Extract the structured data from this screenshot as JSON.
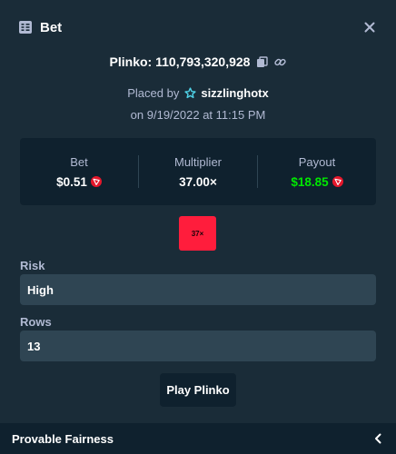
{
  "header": {
    "title": "Bet",
    "icon": "bet-slip-icon",
    "close_icon": "close-icon"
  },
  "bet": {
    "game_title": "Plinko: 110,793,320,928",
    "copy_icon": "copy-icon",
    "link_icon": "link-icon",
    "placed_by_prefix": "Placed by",
    "user_icon": "vip-star-icon",
    "username": "sizzlinghotx",
    "date": "on 9/19/2022 at 11:15 PM"
  },
  "stats": {
    "bet_label": "Bet",
    "bet_value": "$0.51",
    "multiplier_label": "Multiplier",
    "multiplier_value": "37.00×",
    "payout_label": "Payout",
    "payout_value": "$18.85",
    "currency_icon": "tron-coin-icon"
  },
  "result_multiplier": "37×",
  "fields": {
    "risk_label": "Risk",
    "risk_value": "High",
    "rows_label": "Rows",
    "rows_value": "13"
  },
  "play_button": "Play Plinko",
  "footer": {
    "title": "Provable Fairness",
    "chevron_icon": "chevron-left-icon"
  },
  "colors": {
    "background": "#1a2c38",
    "panel": "#0f212e",
    "field": "#2f4553",
    "payout_green": "#00e701",
    "multiplier_red": "#ff1d3c",
    "muted_text": "#b1bad3",
    "coin_red": "#e5172b"
  }
}
